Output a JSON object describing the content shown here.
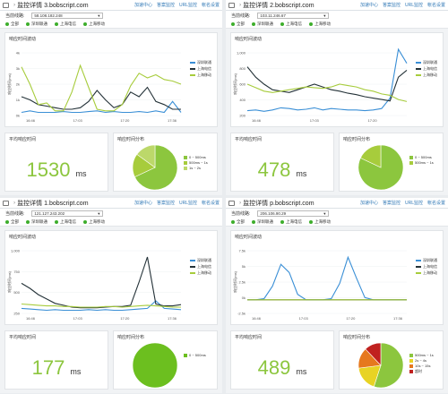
{
  "colors": {
    "lightgreen": "#a7cc3c",
    "blue": "#3a8fd6",
    "dark": "#243238",
    "green": "#3dae2b"
  },
  "panels": [
    {
      "title": "监控详情 3.bobscript.com",
      "ip": "58.108.182.248",
      "chart_data": {
        "type": "line",
        "title": "响应时间波动",
        "ylabel": "响应时间(ms)",
        "y_ticks": [
          "4k",
          "3k",
          "2k",
          "1k",
          "0k"
        ],
        "x_ticks": [
          "16:46",
          "17:03",
          "17:20",
          "17:36"
        ],
        "ylim": [
          0,
          4000
        ],
        "series": [
          {
            "name": "深圳联通",
            "color": "#3a8fd6",
            "values": [
              200,
              300,
              200,
              200,
              200,
              250,
              200,
              200,
              250,
              300,
              200,
              250,
              200,
              200,
              250,
              200,
              300,
              200,
              900,
              200
            ]
          },
          {
            "name": "上海电信",
            "color": "#243238",
            "values": [
              1200,
              1000,
              700,
              600,
              500,
              400,
              400,
              500,
              900,
              1600,
              1000,
              500,
              700,
              1500,
              1200,
              1800,
              900,
              700,
              400,
              400
            ]
          },
          {
            "name": "上海移动",
            "color": "#a7cc3c",
            "values": [
              3100,
              2000,
              700,
              800,
              300,
              300,
              1500,
              3200,
              1800,
              400,
              300,
              300,
              700,
              1900,
              2700,
              2400,
              2600,
              2300,
              2200,
              2000
            ]
          }
        ]
      },
      "avg": {
        "label": "平均响应时间",
        "value": "1530",
        "unit": "ms"
      },
      "pie": {
        "label": "响应时间分布",
        "slices": [
          {
            "label": "0 ~ 500ms",
            "value": 68,
            "color": "#8cc63e"
          },
          {
            "label": "500ms ~ 1s",
            "value": 17,
            "color": "#a7cc3c"
          },
          {
            "label": "1s ~ 2s",
            "value": 15,
            "color": "#bcd86a"
          }
        ]
      }
    },
    {
      "title": "监控详情 2.bobscript.com",
      "ip": "103.11.246.67",
      "chart_data": {
        "type": "line",
        "title": "响应时间波动",
        "ylabel": "响应时间(ms)",
        "y_ticks": [
          "1,000",
          "800",
          "600",
          "400",
          "200"
        ],
        "x_ticks": [
          "16:46",
          "17:03",
          "17:20"
        ],
        "ylim": [
          150,
          1050
        ],
        "series": [
          {
            "name": "深圳联通",
            "color": "#3a8fd6",
            "values": [
              220,
              230,
              210,
              230,
              260,
              250,
              230,
              240,
              260,
              230,
              250,
              240,
              230,
              230,
              220,
              230,
              250,
              400,
              1100,
              900
            ]
          },
          {
            "name": "上海电信",
            "color": "#243238",
            "values": [
              850,
              700,
              600,
              520,
              500,
              480,
              520,
              560,
              600,
              560,
              520,
              500,
              470,
              450,
              420,
              400,
              380,
              360,
              700,
              800
            ]
          },
          {
            "name": "上海移动",
            "color": "#a7cc3c",
            "values": [
              600,
              550,
              500,
              480,
              500,
              520,
              540,
              560,
              550,
              540,
              560,
              600,
              580,
              560,
              520,
              500,
              460,
              440,
              380,
              350
            ]
          }
        ]
      },
      "avg": {
        "label": "平均响应时间",
        "value": "478",
        "unit": "ms"
      },
      "pie": {
        "label": "响应时间分布",
        "slices": [
          {
            "label": "0 ~ 500ms",
            "value": 82,
            "color": "#8cc63e"
          },
          {
            "label": "500ms ~ 1s",
            "value": 18,
            "color": "#a7cc3c"
          }
        ]
      }
    },
    {
      "title": "监控详情 1.bobscript.com",
      "ip": "121.127.243.202",
      "chart_data": {
        "type": "line",
        "title": "响应时间波动",
        "ylabel": "响应时间(ms)",
        "y_ticks": [
          "1,000",
          "750",
          "500",
          "250"
        ],
        "x_ticks": [
          "16:46",
          "17:03",
          "17:20",
          "17:36"
        ],
        "ylim": [
          100,
          1100
        ],
        "series": [
          {
            "name": "深圳联通",
            "color": "#3a8fd6",
            "values": [
              180,
              170,
              160,
              150,
              160,
              150,
              150,
              150,
              160,
              150,
              160,
              150,
              150,
              160,
              170,
              180,
              300,
              180,
              170,
              160
            ]
          },
          {
            "name": "上海电信",
            "color": "#243238",
            "values": [
              580,
              500,
              400,
              330,
              260,
              230,
              200,
              190,
              190,
              190,
              200,
              210,
              210,
              230,
              600,
              1000,
              250,
              220,
              220,
              240
            ]
          },
          {
            "name": "上海移动",
            "color": "#a7cc3c",
            "values": [
              250,
              240,
              230,
              220,
              220,
              210,
              210,
              200,
              200,
              200,
              210,
              210,
              200,
              210,
              220,
              230,
              220,
              210,
              200,
              200
            ]
          }
        ]
      },
      "avg": {
        "label": "平均响应时间",
        "value": "177",
        "unit": "ms"
      },
      "pie": {
        "label": "响应时间分布",
        "slices": [
          {
            "label": "0 ~ 500ms",
            "value": 100,
            "color": "#6cbf1f"
          }
        ]
      }
    },
    {
      "title": "监控详情 p.bobscript.com",
      "ip": "206.106.90.29",
      "chart_data": {
        "type": "line",
        "title": "响应时间波动",
        "ylabel": "响应时间(ms)",
        "y_ticks": [
          "7.5k",
          "5k",
          "2.5k",
          "0k",
          "-2.5k"
        ],
        "x_ticks": [
          "16:46",
          "17:03",
          "17:20",
          "17:36"
        ],
        "ylim": [
          -2500,
          9000
        ],
        "series": [
          {
            "name": "深圳联通",
            "color": "#3a8fd6",
            "values": [
              0,
              0,
              200,
              2500,
              6500,
              5000,
              1000,
              0,
              0,
              0,
              200,
              3000,
              7800,
              4000,
              400,
              0,
              0,
              0,
              0,
              0
            ]
          },
          {
            "name": "上海电信",
            "color": "#243238",
            "values": [
              0,
              0,
              0,
              0,
              0,
              0,
              0,
              0,
              0,
              0,
              0,
              0,
              0,
              0,
              0,
              0,
              0,
              0,
              0,
              0
            ]
          },
          {
            "name": "上海移动",
            "color": "#a7cc3c",
            "values": [
              0,
              0,
              0,
              0,
              0,
              0,
              0,
              0,
              0,
              0,
              0,
              0,
              0,
              0,
              0,
              0,
              0,
              0,
              0,
              0
            ]
          }
        ]
      },
      "avg": {
        "label": "平均响应时间",
        "value": "489",
        "unit": "ms"
      },
      "pie": {
        "label": "响应时间分布",
        "slices": [
          {
            "label": "500ms ~ 1s",
            "value": 55,
            "color": "#8cc63e"
          },
          {
            "label": "2s ~ 4s",
            "value": 18,
            "color": "#e8d324"
          },
          {
            "label": "10s ~ 15s",
            "value": 15,
            "color": "#e6781e"
          },
          {
            "label": "超时",
            "value": 12,
            "color": "#c0211f"
          }
        ]
      }
    }
  ],
  "header_links": [
    "加速中心",
    "答案监控",
    "URL监控",
    "帐名设置"
  ],
  "ip_label": "当前线路:",
  "legend_items": [
    "全部",
    "深圳联通",
    "上海电信",
    "上海移动"
  ]
}
